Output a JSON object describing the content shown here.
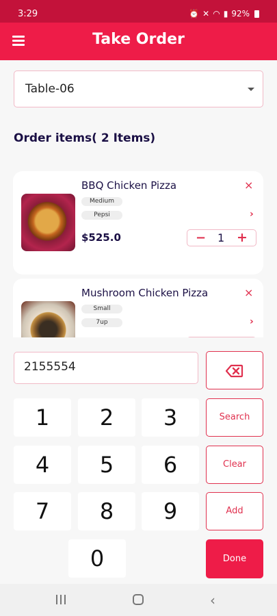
{
  "status_bar": {
    "time": "3:29",
    "battery": "92%",
    "icons": [
      "alarm-icon",
      "mute-icon",
      "wifi-icon",
      "signal-icon",
      "battery-icon"
    ]
  },
  "app_bar": {
    "title": "Take Order",
    "menu_icon": "hamburger-menu-icon"
  },
  "table_select": {
    "value": "Table-06"
  },
  "order": {
    "heading": "Order items( 2 Items)",
    "items": [
      {
        "name": "BBQ Chicken Pizza",
        "size": "Medium",
        "drink": "Pepsi",
        "price": "$525.0",
        "quantity": "1",
        "minus": "−",
        "plus": "+"
      },
      {
        "name": "Mushroom Chicken Pizza",
        "size": "Small",
        "drink": "7up"
      }
    ],
    "remove_icon": "×",
    "detail_icon": "›"
  },
  "keypad": {
    "input_value": "2155554",
    "keys": [
      "1",
      "2",
      "3",
      "4",
      "5",
      "6",
      "7",
      "8",
      "9",
      "0"
    ],
    "search_label": "Search",
    "clear_label": "Clear",
    "add_label": "Add",
    "done_label": "Done"
  },
  "colors": {
    "accent": "#ee1c48",
    "status_bar": "#c3123a",
    "border": "#f1b9c6",
    "heading": "#1b1045"
  }
}
